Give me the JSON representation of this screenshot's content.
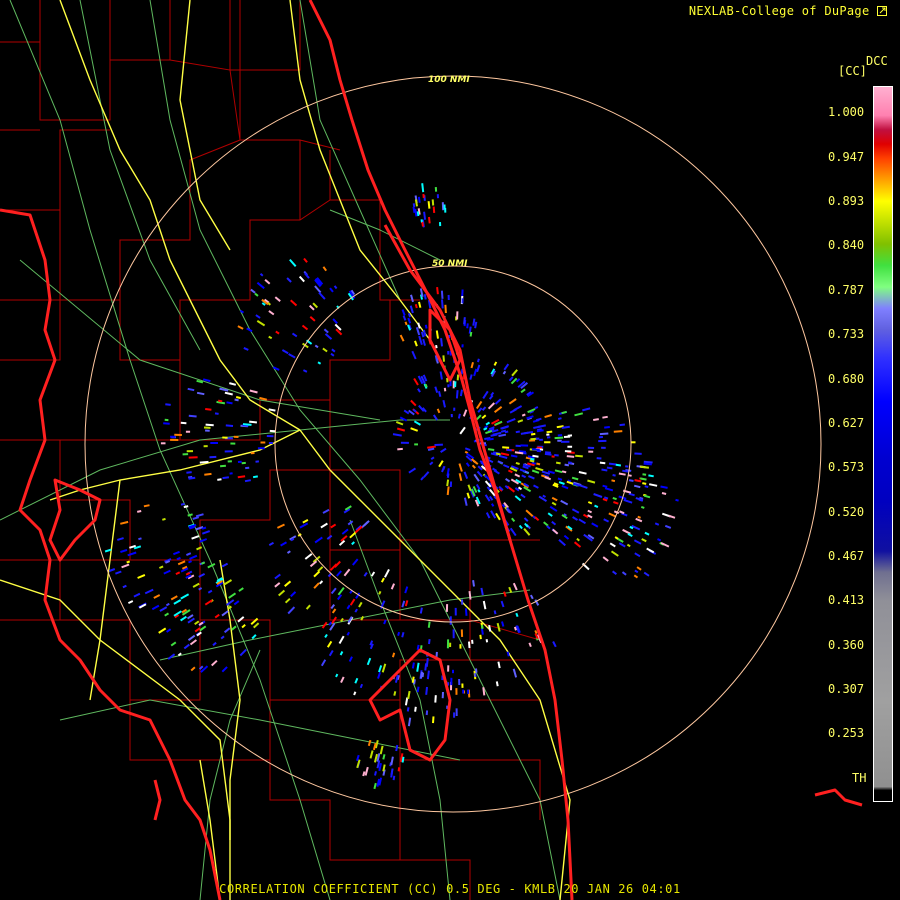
{
  "credit": "NEXLAB-College of DuPage",
  "credit_icon": "external-link-icon",
  "footer": "CORRELATION COEFFICIENT (CC) 0.5 DEG - KMLB 20 JAN 26 04:01",
  "product_short": "DCC",
  "product_unit": "[CC]",
  "range_rings": {
    "inner": "50 NMI",
    "outer": "100 NMI"
  },
  "colorbar_ticks": [
    "1.000",
    "0.947",
    "0.893",
    "0.840",
    "0.787",
    "0.733",
    "0.680",
    "0.627",
    "0.573",
    "0.520",
    "0.467",
    "0.413",
    "0.360",
    "0.307",
    "0.253"
  ],
  "threshold_label": "TH",
  "colors": {
    "coastline": "#ff2020",
    "county_lines": "#c00000",
    "highways": "#ffff44",
    "roads": "#60c060",
    "range_ring": "#ffc8a0",
    "background": "#000000"
  }
}
